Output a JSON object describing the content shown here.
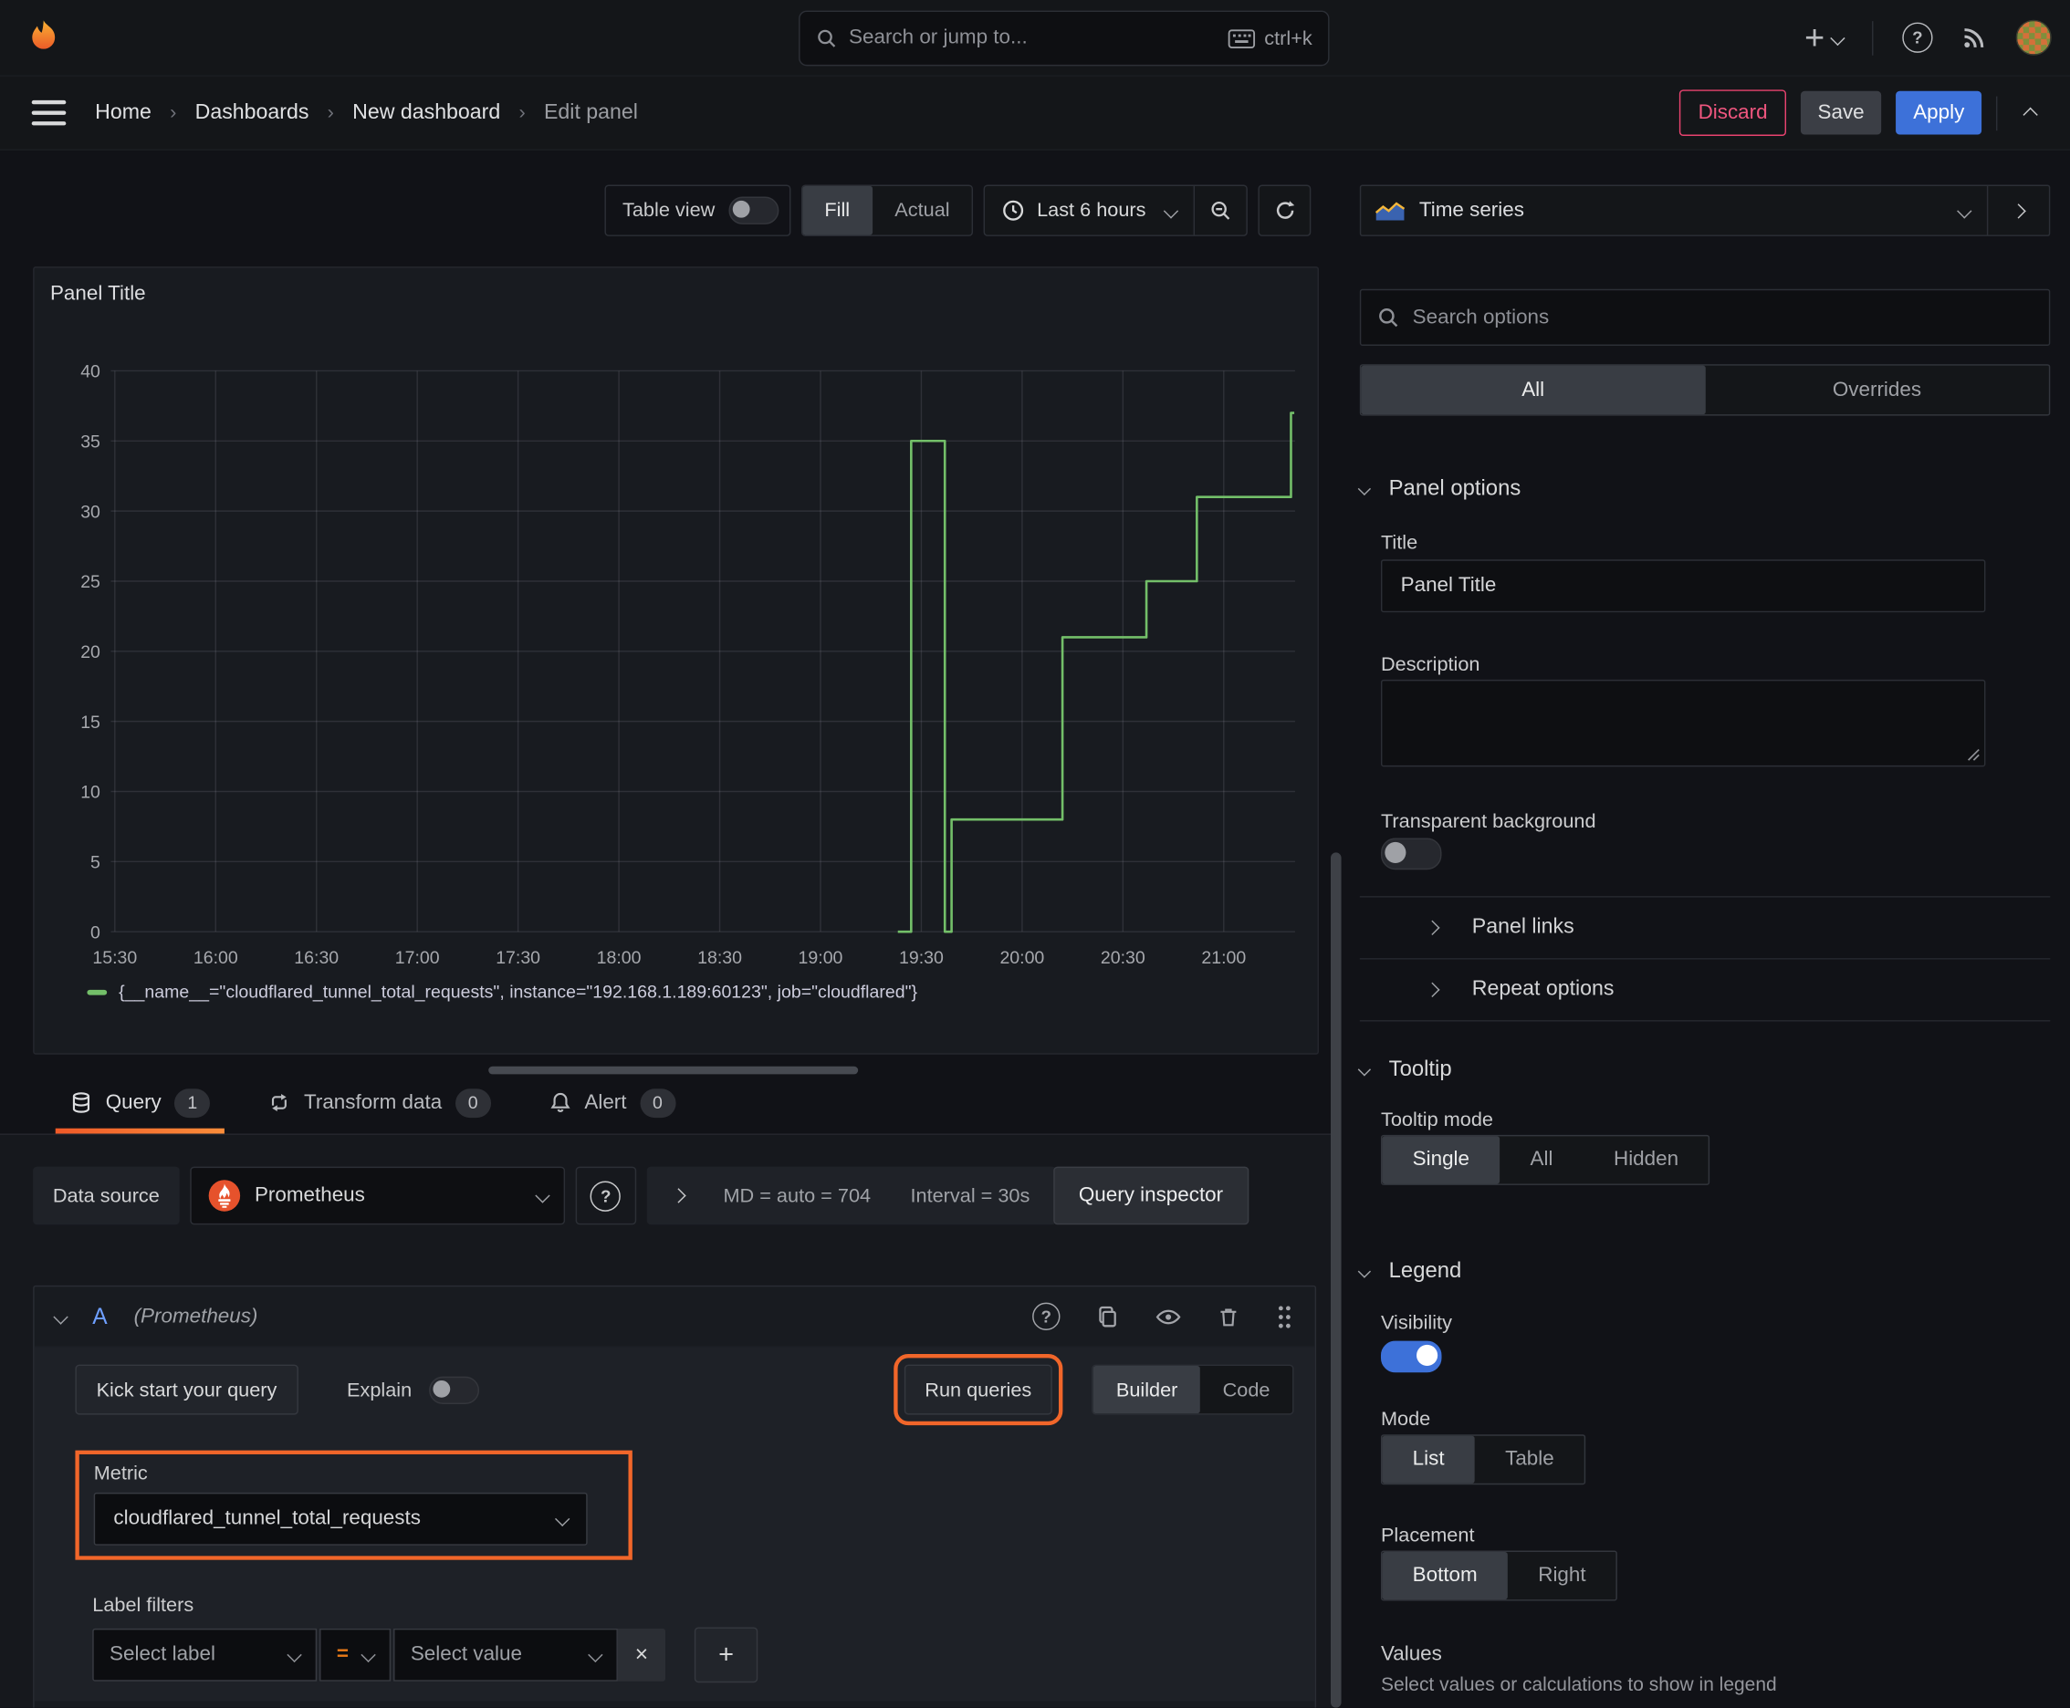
{
  "topbar": {
    "search_placeholder": "Search or jump to...",
    "shortcut": "ctrl+k"
  },
  "breadcrumb": {
    "items": [
      "Home",
      "Dashboards",
      "New dashboard"
    ],
    "current": "Edit panel"
  },
  "nav_actions": {
    "discard": "Discard",
    "save": "Save",
    "apply": "Apply"
  },
  "panel_toolbar": {
    "table_view": "Table view",
    "fill": "Fill",
    "actual": "Actual",
    "time_range": "Last 6 hours"
  },
  "panel": {
    "title": "Panel Title"
  },
  "chart_data": {
    "type": "line",
    "title": "Panel Title",
    "x_ticks": [
      "15:30",
      "16:00",
      "16:30",
      "17:00",
      "17:30",
      "18:00",
      "18:30",
      "19:00",
      "19:30",
      "20:00",
      "20:30",
      "21:00"
    ],
    "tick_interval_min": 30,
    "y_ticks": [
      0,
      5,
      10,
      15,
      20,
      25,
      30,
      35,
      40
    ],
    "ylim": [
      0,
      40
    ],
    "xlim_minutes": [
      0,
      351
    ],
    "grid": true,
    "legend_position": "bottom",
    "series": [
      {
        "name": "{__name__=\"cloudflared_tunnel_total_requests\", instance=\"192.168.1.189:60123\", job=\"cloudflared\"}",
        "color": "#73bf69",
        "step_points": [
          [
            233,
            0
          ],
          [
            237,
            0
          ],
          [
            237,
            35
          ],
          [
            247,
            35
          ],
          [
            247,
            0
          ],
          [
            249,
            0
          ],
          [
            249,
            8
          ],
          [
            282,
            8
          ],
          [
            282,
            21
          ],
          [
            307,
            21
          ],
          [
            307,
            25
          ],
          [
            322,
            25
          ],
          [
            322,
            31
          ],
          [
            350,
            31
          ],
          [
            350,
            37
          ],
          [
            351,
            37
          ]
        ]
      }
    ]
  },
  "tabs": {
    "query": "Query",
    "query_count": "1",
    "transform": "Transform data",
    "transform_count": "0",
    "alert": "Alert",
    "alert_count": "0"
  },
  "datasource_row": {
    "label": "Data source",
    "value": "Prometheus",
    "stats_md": "MD = auto = 704",
    "stats_interval": "Interval = 30s",
    "inspector": "Query inspector"
  },
  "query_editor": {
    "ref_id": "A",
    "ds_hint": "(Prometheus)",
    "kick_start": "Kick start your query",
    "explain": "Explain",
    "run_queries": "Run queries",
    "builder": "Builder",
    "code": "Code",
    "metric_label": "Metric",
    "metric_value": "cloudflared_tunnel_total_requests",
    "label_filters_label": "Label filters",
    "select_label": "Select label",
    "operator": "=",
    "select_value": "Select value"
  },
  "options_pane": {
    "viz_type": "Time series",
    "search_placeholder": "Search options",
    "tab_all": "All",
    "tab_overrides": "Overrides",
    "panel_options": {
      "heading": "Panel options",
      "title_label": "Title",
      "title_value": "Panel Title",
      "description_label": "Description",
      "transparent_label": "Transparent background",
      "panel_links": "Panel links",
      "repeat_options": "Repeat options"
    },
    "tooltip": {
      "heading": "Tooltip",
      "mode_label": "Tooltip mode",
      "modes": [
        "Single",
        "All",
        "Hidden"
      ]
    },
    "legend": {
      "heading": "Legend",
      "visibility_label": "Visibility",
      "mode_label": "Mode",
      "modes": [
        "List",
        "Table"
      ],
      "placement_label": "Placement",
      "placements": [
        "Bottom",
        "Right"
      ],
      "values_label": "Values",
      "values_help": "Select values or calculations to show in legend"
    }
  },
  "icons": {
    "close": "×",
    "add": "+",
    "question": "?"
  },
  "colors": {
    "accent_orange": "#f05a28",
    "annotation_orange": "#f1662a",
    "series_green": "#73bf69",
    "primary_blue": "#3d71d9",
    "discard_pink": "#e8436f",
    "prometheus_orange": "#e6522c"
  }
}
